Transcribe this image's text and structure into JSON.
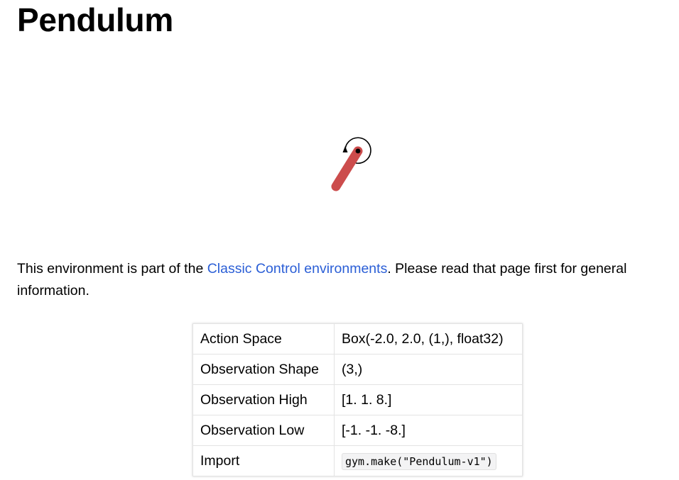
{
  "page": {
    "title": "Pendulum"
  },
  "figure": {
    "icon": "pendulum-diagram-icon",
    "rod_color": "#cc4c4c",
    "pivot_color": "#000000"
  },
  "intro": {
    "text_before": "This environment is part of the ",
    "link_text": "Classic Control environments",
    "text_after": ". Please read that page first for general information.",
    "link_color": "#2a5ed6"
  },
  "spec_table": {
    "rows": [
      {
        "key": "Action Space",
        "value": "Box(-2.0, 2.0, (1,), float32)"
      },
      {
        "key": "Observation Shape",
        "value": "(3,)"
      },
      {
        "key": "Observation High",
        "value": "[1. 1. 8.]"
      },
      {
        "key": "Observation Low",
        "value": "[-1. -1. -8.]"
      },
      {
        "key": "Import",
        "value": "gym.make(\"Pendulum-v1\")"
      }
    ]
  }
}
